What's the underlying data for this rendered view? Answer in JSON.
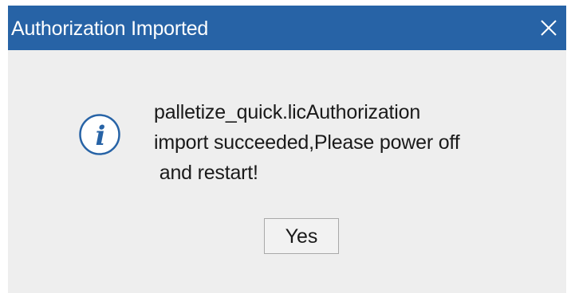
{
  "dialog": {
    "title": "Authorization Imported",
    "close_icon": "close-icon",
    "info_icon": "info-icon",
    "message_lines": [
      "palletize_quick.licAuthorization",
      "import succeeded,Please power off",
      " and restart!"
    ],
    "yes_label": "Yes"
  },
  "colors": {
    "titlebar": "#2763a6",
    "body": "#eeeeee",
    "icon": "#2763a6"
  }
}
